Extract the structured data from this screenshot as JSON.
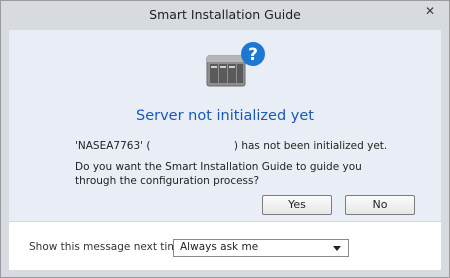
{
  "window": {
    "title": "Smart Installation Guide",
    "close_glyph": "✕"
  },
  "dialog": {
    "headline": "Server not initialized yet",
    "line1_prefix": "'NASEA7763' (",
    "line1_suffix": ") has not been initialized yet.",
    "line2": "Do you want the Smart Installation Guide to guide you through the configuration process?",
    "yes_label": "Yes",
    "no_label": "No",
    "icon": "nas-server-question-icon"
  },
  "footer": {
    "label": "Show this message next time?",
    "select_value": "Always ask me"
  },
  "colors": {
    "headline": "#1659b8",
    "content_bg": "#e9eef6",
    "question_badge": "#1f77d4"
  }
}
